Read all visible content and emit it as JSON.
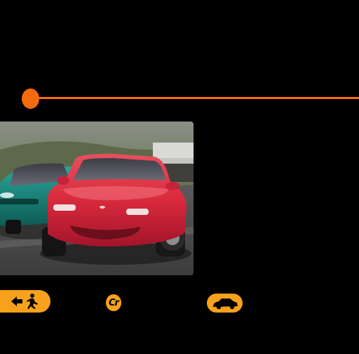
{
  "colors": {
    "accent": "#f56a0e",
    "background": "#000000",
    "button": "#f7a21a"
  },
  "header": {
    "line_icon": "orange-dot-and-line"
  },
  "preview": {
    "image_icon": "red-roadster-race-photo"
  },
  "toolbar": {
    "exit_icon": "back-arrow-running-person-icon",
    "credits_label": "Cr",
    "car_icon": "car-icon"
  }
}
